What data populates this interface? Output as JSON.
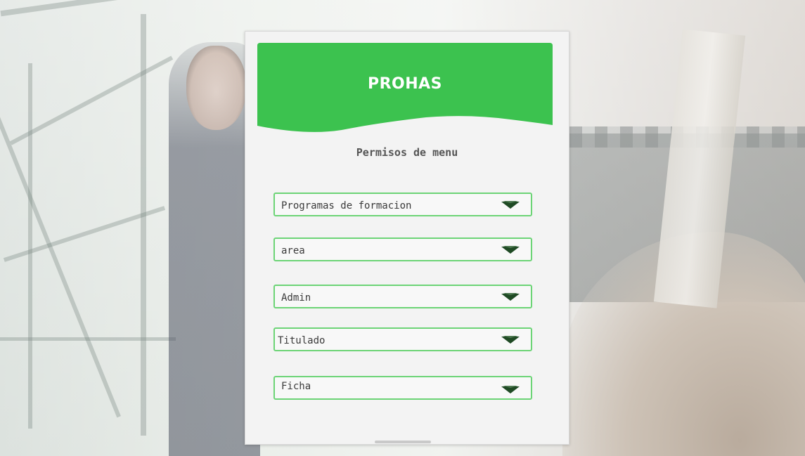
{
  "card": {
    "brand": "PROHAS",
    "subtitle": "Permisos de menu"
  },
  "selects": [
    {
      "label": "Programas de formacion"
    },
    {
      "label": "area"
    },
    {
      "label": "Admin"
    },
    {
      "label": "Titulado"
    },
    {
      "label": "Ficha"
    }
  ],
  "colors": {
    "accent": "#3cc24f",
    "border": "#6cd476",
    "arrow": "#1f4a24"
  }
}
